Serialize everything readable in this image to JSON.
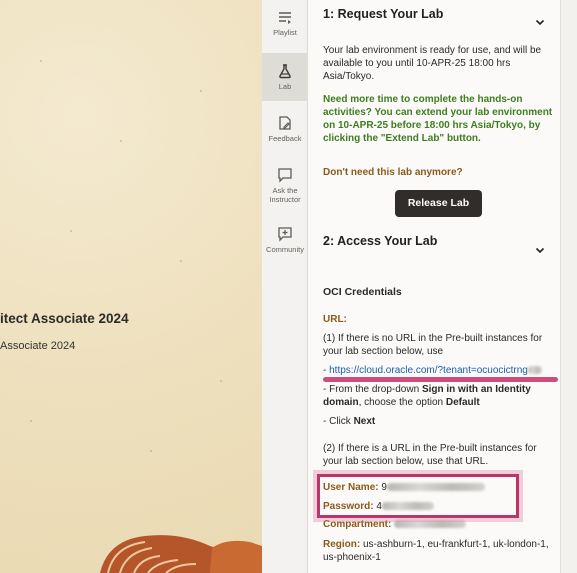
{
  "course": {
    "title": "itect Associate 2024",
    "subtitle": "Associate 2024"
  },
  "rail": {
    "items": [
      {
        "label": "Playlist",
        "icon": "playlist-icon"
      },
      {
        "label": "Lab",
        "icon": "flask-icon"
      },
      {
        "label": "Feedback",
        "icon": "feedback-icon"
      },
      {
        "label": "Ask the Instructor",
        "icon": "chat-icon"
      },
      {
        "label": "Community",
        "icon": "community-icon"
      }
    ]
  },
  "sections": {
    "request": {
      "title": "1: Request Your Lab",
      "ready_text": "Your lab environment is ready for use, and will be available to you until 10-APR-25 18:00 hrs Asia/Tokyo.",
      "extend_text": "Need more time to complete the hands-on activities? You can extend your lab environment on 10-APR-25 before 18:00 hrs Asia/Tokyo, by clicking the \"Extend Lab\" button.",
      "dont_need": "Don't need this lab anymore?",
      "release_button": "Release Lab"
    },
    "access": {
      "title": "2: Access Your Lab",
      "credentials_heading": "OCI Credentials",
      "url_label": "URL:",
      "step1": "(1) If there is no URL in the Pre-built instances for your lab section below, use",
      "url_prefix": "- ",
      "url_link": "https://cloud.oracle.com/?tenant=ocuocictrng",
      "from_dropdown_prefix": "- From the drop-down ",
      "from_dropdown_bold": "Sign in with an Identity domain",
      "from_dropdown_mid": ", choose the option ",
      "from_dropdown_default": "Default",
      "click_prefix": "- Click ",
      "click_next": "Next",
      "step2": "(2) If there is a URL in the Pre-built instances for your lab section below, use that URL.",
      "username_label": "User Name:",
      "username_start": "9",
      "password_label": "Password:",
      "password_start": "4",
      "compartment_label": "Compartment:",
      "region_label": "Region:",
      "region_value": "us-ashburn-1, eu-frankfurt-1, uk-london-1, us-phoenix-1"
    }
  },
  "colors": {
    "green": "#3f7d20",
    "brown": "#8b5a1a",
    "link": "#1a5fa8",
    "button_bg": "#312d2a",
    "highlight": "#c93a6e"
  }
}
